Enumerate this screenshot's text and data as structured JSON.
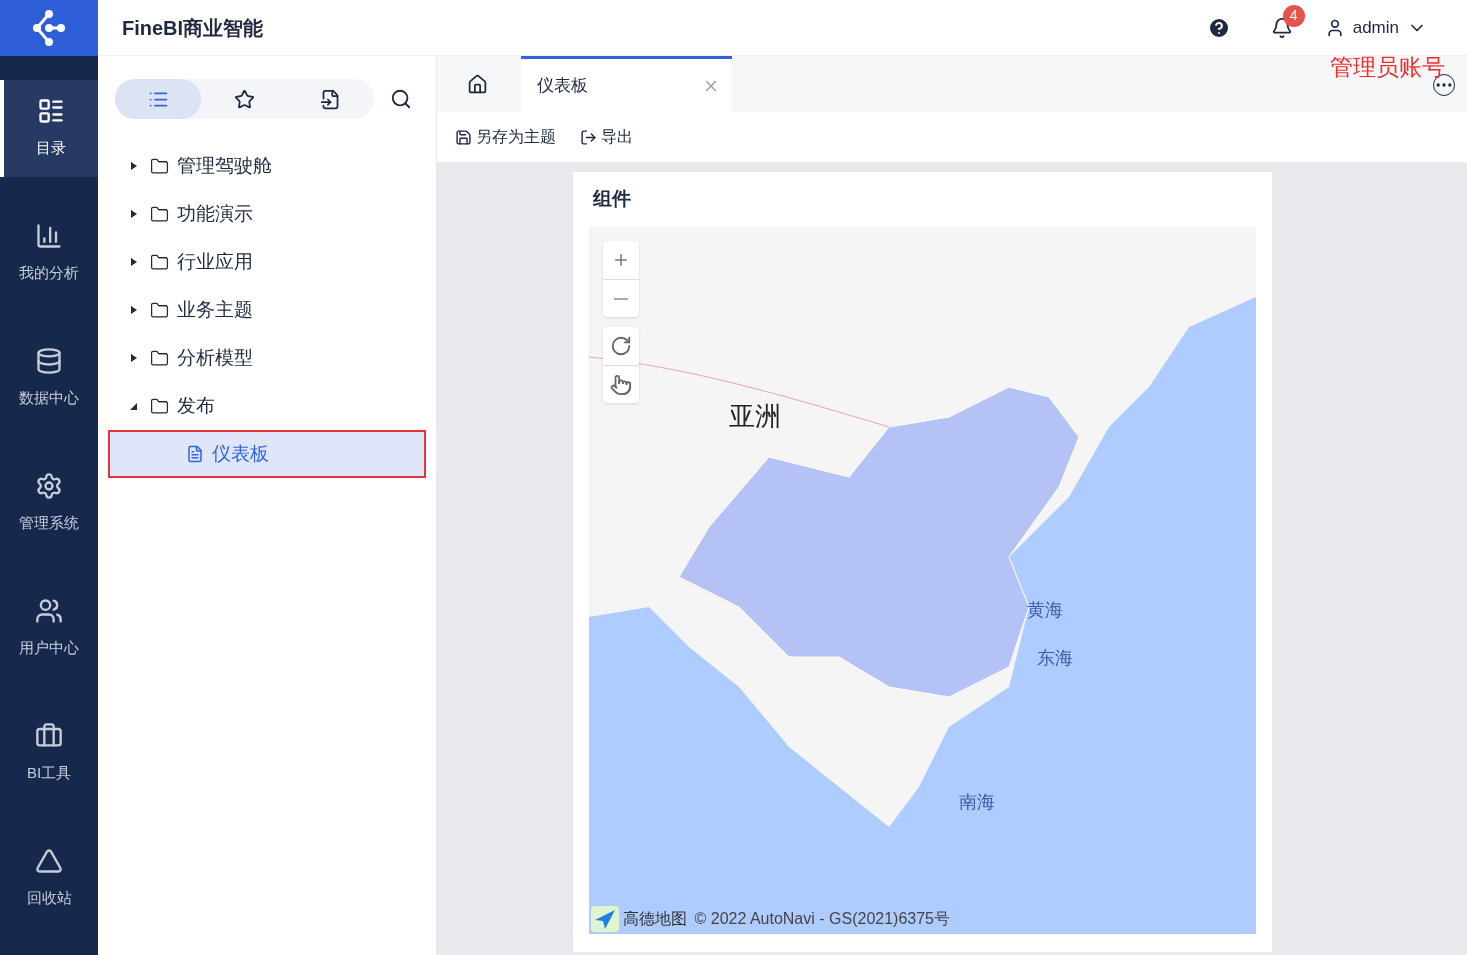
{
  "header": {
    "title": "FineBI商业智能",
    "notifications": "4",
    "user": "admin",
    "annotation": "管理员账号"
  },
  "nav": [
    {
      "label": "目录",
      "selected": true
    },
    {
      "label": "我的分析",
      "selected": false
    },
    {
      "label": "数据中心",
      "selected": false
    },
    {
      "label": "管理系统",
      "selected": false
    },
    {
      "label": "用户中心",
      "selected": false
    },
    {
      "label": "BI工具",
      "selected": false
    },
    {
      "label": "回收站",
      "selected": false
    }
  ],
  "panel_tabs": [
    {
      "selected": true
    },
    {
      "selected": false
    },
    {
      "selected": false
    }
  ],
  "tree": [
    {
      "label": "管理驾驶舱",
      "expanded": false
    },
    {
      "label": "功能演示",
      "expanded": false
    },
    {
      "label": "行业应用",
      "expanded": false
    },
    {
      "label": "业务主题",
      "expanded": false
    },
    {
      "label": "分析模型",
      "expanded": false
    },
    {
      "label": "发布",
      "expanded": true,
      "children": [
        {
          "label": "仪表板",
          "selected": true
        }
      ]
    }
  ],
  "tabs": [
    {
      "label": "仪表板",
      "selected": true
    }
  ],
  "toolbar": [
    "另存为主题",
    "导出"
  ],
  "widget": {
    "title": "组件",
    "map_labels": [
      {
        "text": "亚洲",
        "kind": "continent"
      },
      {
        "text": "黄海",
        "kind": "sea"
      },
      {
        "text": "东海",
        "kind": "sea"
      },
      {
        "text": "南海",
        "kind": "sea"
      }
    ],
    "logo_text": "高德地图",
    "attribution": "© 2022 AutoNavi - GS(2021)6375号"
  }
}
